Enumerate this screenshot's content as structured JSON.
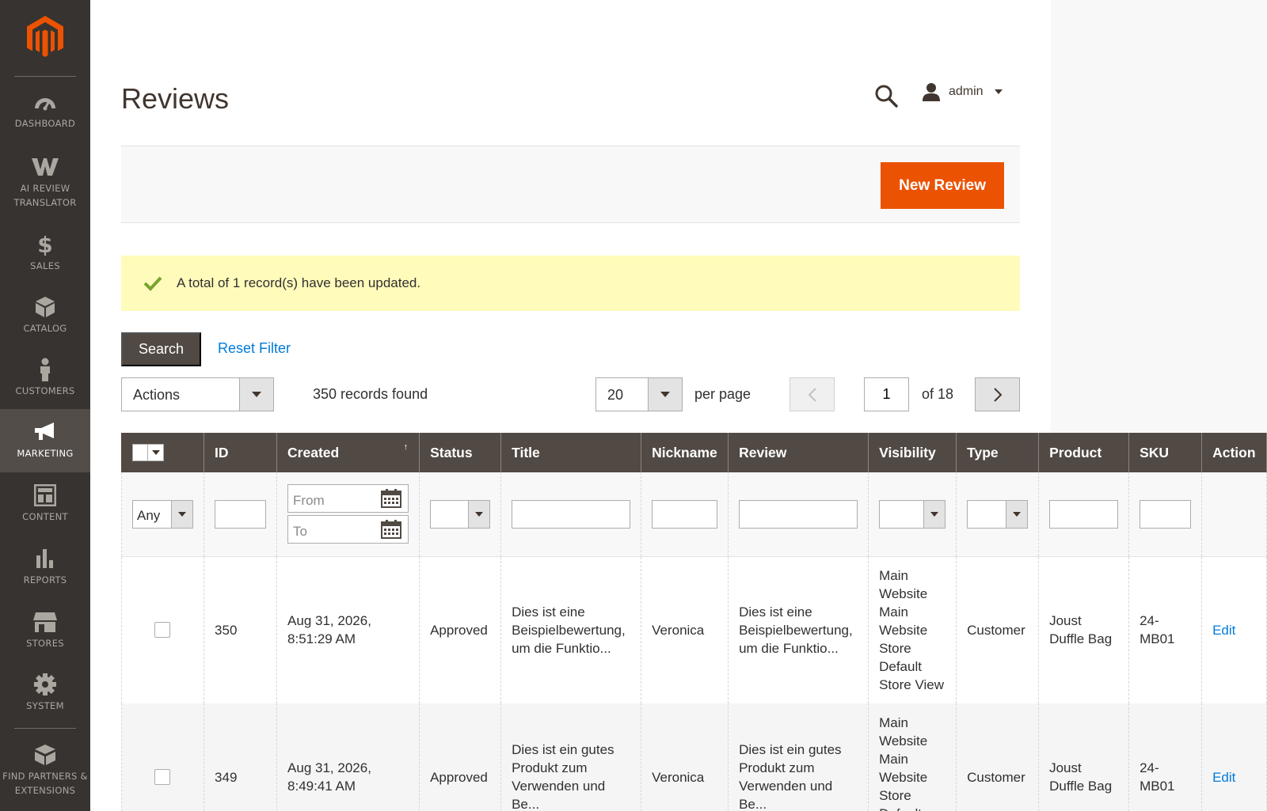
{
  "sidebar": {
    "items": [
      {
        "label": "DASHBOARD",
        "icon": "dashboard-icon"
      },
      {
        "label": "AI REVIEW TRANSLATOR",
        "icon": "translator-w-icon"
      },
      {
        "label": "SALES",
        "icon": "dollar-icon"
      },
      {
        "label": "CATALOG",
        "icon": "box-icon"
      },
      {
        "label": "CUSTOMERS",
        "icon": "person-icon"
      },
      {
        "label": "MARKETING",
        "icon": "megaphone-icon"
      },
      {
        "label": "CONTENT",
        "icon": "layout-icon"
      },
      {
        "label": "REPORTS",
        "icon": "bar-chart-icon"
      },
      {
        "label": "STORES",
        "icon": "storefront-icon"
      },
      {
        "label": "SYSTEM",
        "icon": "gear-icon"
      },
      {
        "label": "FIND PARTNERS & EXTENSIONS",
        "icon": "blocks-icon"
      }
    ],
    "active": "MARKETING",
    "colors": {
      "bg": "#373330",
      "active_bg": "#524d49",
      "logo": "#eb5202"
    }
  },
  "header": {
    "title": "Reviews",
    "user": "admin"
  },
  "actions": {
    "new_review": "New Review"
  },
  "message": {
    "text": "A total of 1 record(s) have been updated."
  },
  "toolbar": {
    "search": "Search",
    "reset_filter": "Reset Filter",
    "mass_action": "Actions",
    "records_found": "350 records found",
    "per_page_value": "20",
    "per_page_label": "per page",
    "current_page": "1",
    "total_pages": "of 18"
  },
  "grid": {
    "columns": [
      "ID",
      "Created",
      "Status",
      "Title",
      "Nickname",
      "Review",
      "Visibility",
      "Type",
      "Product",
      "SKU",
      "Action"
    ],
    "filters": {
      "mass": "Any",
      "date_from": "From",
      "date_to": "To"
    },
    "rows": [
      {
        "id": "350",
        "created": "Aug 31, 2026, 8:51:29 AM",
        "status": "Approved",
        "title": "Dies ist eine Beispielbewertung, um die Funktio...",
        "nickname": "Veronica",
        "review": "Dies ist eine Beispielbewertung, um die Funktio...",
        "visibility": "Main Website Main Website Store Default Store View",
        "type": "Customer",
        "product": "Joust Duffle Bag",
        "sku": "24-MB01",
        "action": "Edit"
      },
      {
        "id": "349",
        "created": "Aug 31, 2026, 8:49:41 AM",
        "status": "Approved",
        "title": "Dies ist ein gutes Produkt zum Verwenden und Be...",
        "nickname": "Veronica",
        "review": "Dies ist ein gutes Produkt zum Verwenden und Be...",
        "visibility": "Main Website Main Website Store Default Store View",
        "type": "Customer",
        "product": "Joust Duffle Bag",
        "sku": "24-MB01",
        "action": "Edit"
      }
    ]
  }
}
